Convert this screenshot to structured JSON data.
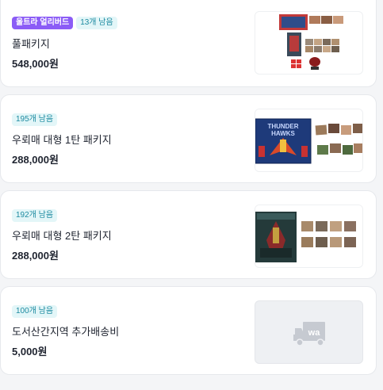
{
  "items": [
    {
      "badges": [
        "울트라 얼리버드",
        "13개 남음"
      ],
      "title": "풀패키지",
      "price": "548,000원",
      "thumb_icon": "product-collage-image"
    },
    {
      "badges": [
        "195개 남음"
      ],
      "title": "우뢰매 대형 1탄 패키지",
      "price": "288,000원",
      "thumb_icon": "thunder-hawks-box-image",
      "thumb_text": [
        "THUNDER",
        "HAWKS"
      ]
    },
    {
      "badges": [
        "192개 남음"
      ],
      "title": "우뢰매 대형 2탄 패키지",
      "price": "288,000원",
      "thumb_icon": "robot-box-photos-image"
    },
    {
      "badges": [
        "100개 남음"
      ],
      "title": "도서산간지역 추가배송비",
      "price": "5,000원",
      "thumb_icon": "delivery-truck-icon",
      "thumb_text": [
        "wa"
      ]
    }
  ],
  "colors": {
    "ultra_badge_bg": "#8b5cf6",
    "stock_badge_bg": "#e3f6f8",
    "stock_badge_text": "#1c8aa0"
  }
}
